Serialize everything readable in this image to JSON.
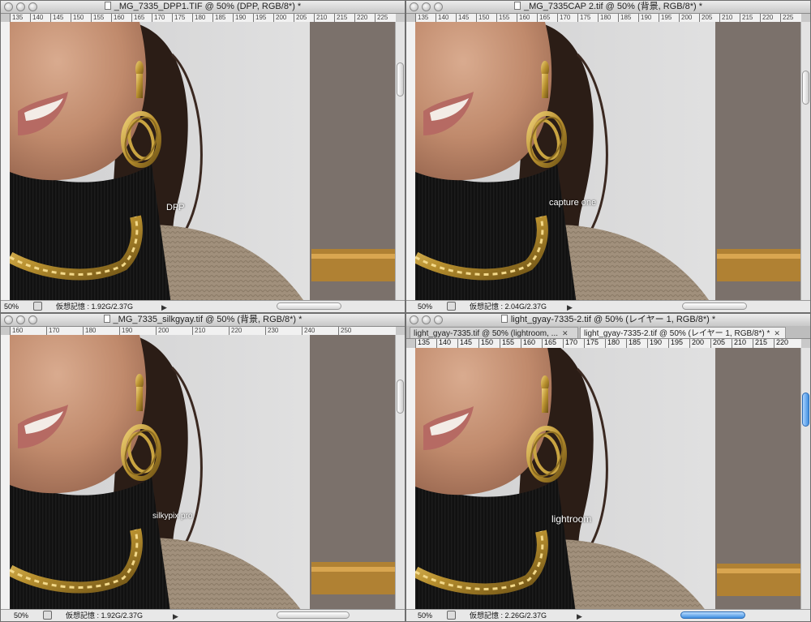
{
  "windows": {
    "top_left": {
      "title": "_MG_7335_DPP1.TIF @ 50% (DPP, RGB/8*) *",
      "ruler_ticks": [
        "135",
        "140",
        "145",
        "150",
        "155",
        "160",
        "165",
        "170",
        "175",
        "180",
        "185",
        "190",
        "195",
        "200",
        "205",
        "210",
        "215",
        "220",
        "225"
      ],
      "label": "DPP",
      "zoom": "50%",
      "memory": "仮想記憶 : 1.92G/2.37G"
    },
    "top_right": {
      "title": "_MG_7335CAP 2.tif @ 50% (背景, RGB/8*) *",
      "ruler_ticks": [
        "135",
        "140",
        "145",
        "150",
        "155",
        "160",
        "165",
        "170",
        "175",
        "180",
        "185",
        "190",
        "195",
        "200",
        "205",
        "210",
        "215",
        "220",
        "225"
      ],
      "label": "capture one",
      "zoom": "50%",
      "memory": "仮想記憶 : 2.04G/2.37G"
    },
    "bottom_left": {
      "title": "_MG_7335_silkgyay.tif @ 50% (背景, RGB/8*) *",
      "ruler_ticks": [
        "160",
        "170",
        "180",
        "190",
        "200",
        "210",
        "220",
        "230",
        "240",
        "250"
      ],
      "label": "silkypix pro",
      "zoom": "50%",
      "memory": "仮想記憶 : 1.92G/2.37G"
    },
    "bottom_right": {
      "title": "light_gyay-7335-2.tif @ 50% (レイヤー 1, RGB/8*) *",
      "tabs": [
        {
          "label": "light_gyay-7335.tif @ 50% (lightroom, ..."
        },
        {
          "label": "light_gyay-7335-2.tif @ 50% (レイヤー 1, RGB/8*) *"
        }
      ],
      "ruler_ticks": [
        "135",
        "140",
        "145",
        "150",
        "155",
        "160",
        "165",
        "170",
        "175",
        "180",
        "185",
        "190",
        "195",
        "200",
        "205",
        "210",
        "215",
        "220"
      ],
      "label": "lightroom",
      "zoom": "50%",
      "memory": "仮想記憶 : 2.26G/2.37G"
    }
  }
}
